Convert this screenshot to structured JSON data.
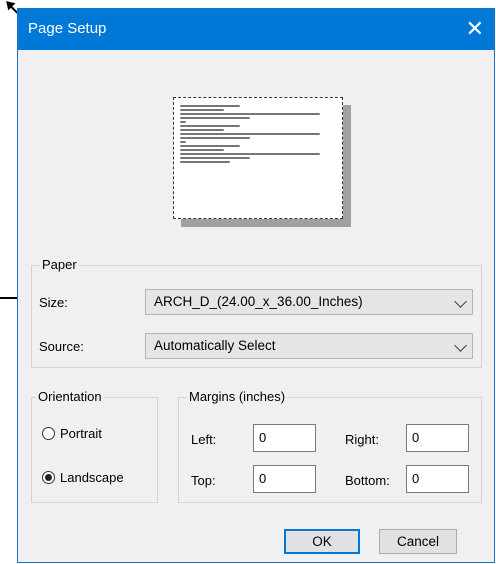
{
  "window": {
    "title": "Page Setup",
    "close_glyph": "✕"
  },
  "paper": {
    "label": "Paper",
    "size_label": "Size:",
    "size_value": "ARCH_D_(24.00_x_36.00_Inches)",
    "source_label": "Source:",
    "source_value": "Automatically Select"
  },
  "orientation": {
    "label": "Orientation",
    "portrait_label": "Portrait",
    "landscape_label": "Landscape",
    "selected": "landscape"
  },
  "margins": {
    "label": "Margins (inches)",
    "left_label": "Left:",
    "left_value": "0",
    "right_label": "Right:",
    "right_value": "0",
    "top_label": "Top:",
    "top_value": "0",
    "bottom_label": "Bottom:",
    "bottom_value": "0"
  },
  "buttons": {
    "ok_label": "OK",
    "cancel_label": "Cancel"
  },
  "colors": {
    "titlebar": "#0078d7",
    "dialog_bg": "#f0f0f0"
  },
  "icons": {
    "close": "close-icon",
    "dropdown": "chevron-down-icon"
  }
}
